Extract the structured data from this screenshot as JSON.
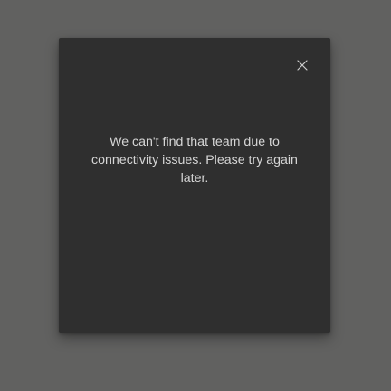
{
  "dialog": {
    "message": "We can't find that team due to connectivity issues. Please try again later.",
    "close_icon": "close-icon"
  },
  "colors": {
    "backdrop": "#616160",
    "dialog_bg": "#2f2f2f",
    "text": "#d6d6d6",
    "icon": "#cfcfcf"
  }
}
